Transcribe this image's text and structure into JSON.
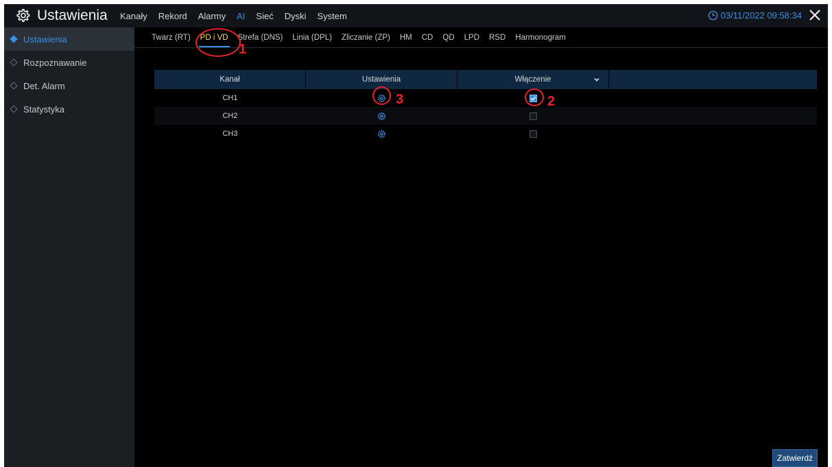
{
  "app": {
    "title": "Ustawienia",
    "datetime": "03/11/2022 09:58:34"
  },
  "menu": [
    {
      "label": "Kanały",
      "active": false
    },
    {
      "label": "Rekord",
      "active": false
    },
    {
      "label": "Alarmy",
      "active": false
    },
    {
      "label": "AI",
      "active": true
    },
    {
      "label": "Sieć",
      "active": false
    },
    {
      "label": "Dyski",
      "active": false
    },
    {
      "label": "System",
      "active": false
    }
  ],
  "sidebar": {
    "items": [
      {
        "label": "Ustawienia",
        "active": true
      },
      {
        "label": "Rozpoznawanie",
        "active": false
      },
      {
        "label": "Det. Alarm",
        "active": false
      },
      {
        "label": "Statystyka",
        "active": false
      }
    ]
  },
  "subtabs": [
    {
      "label": "Twarz (RT)",
      "active": false
    },
    {
      "label": "PD i VD",
      "active": true
    },
    {
      "label": "Strefa (DNS)",
      "active": false
    },
    {
      "label": "Linia (DPL)",
      "active": false
    },
    {
      "label": "Zliczanie (ZP)",
      "active": false
    },
    {
      "label": "HM",
      "active": false
    },
    {
      "label": "CD",
      "active": false
    },
    {
      "label": "QD",
      "active": false
    },
    {
      "label": "LPD",
      "active": false
    },
    {
      "label": "RSD",
      "active": false
    },
    {
      "label": "Harmonogram",
      "active": false
    }
  ],
  "table": {
    "headers": [
      "Kanał",
      "Ustawienia",
      "Włączenie",
      ""
    ],
    "rows": [
      {
        "channel": "CH1",
        "enabled": true
      },
      {
        "channel": "CH2",
        "enabled": false
      },
      {
        "channel": "CH3",
        "enabled": false
      }
    ]
  },
  "annotations": [
    "1",
    "2",
    "3"
  ],
  "confirm_label": "Zatwierdź",
  "colors": {
    "accent": "#3b8fe3",
    "active_tab": "#ffd94a",
    "annotation": "#e8202a",
    "header_bg": "#0f2740"
  }
}
